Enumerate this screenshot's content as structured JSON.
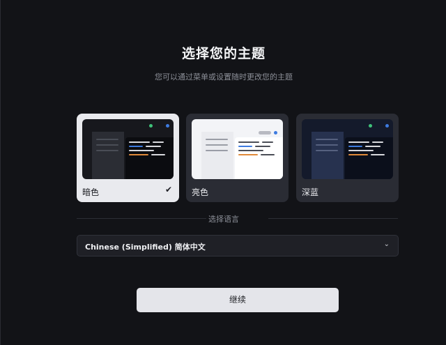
{
  "header": {
    "title": "选择您的主题",
    "subtitle": "您可以通过菜单或设置随时更改您的主题"
  },
  "themes": [
    {
      "label": "暗色",
      "selected": true,
      "check": "✔"
    },
    {
      "label": "亮色",
      "selected": false
    },
    {
      "label": "深蓝",
      "selected": false
    }
  ],
  "language": {
    "section_label": "选择语言",
    "selected_value": "Chinese (Simplified) 简体中文",
    "chevron": "⌄"
  },
  "actions": {
    "continue_label": "继续"
  },
  "colors": {
    "background": "#121317",
    "card_selected": "#e9eaee",
    "card_default": "#2a2c34",
    "accent_green": "#3fc27a",
    "accent_blue": "#3d7be0",
    "accent_orange": "#e08a3a"
  }
}
